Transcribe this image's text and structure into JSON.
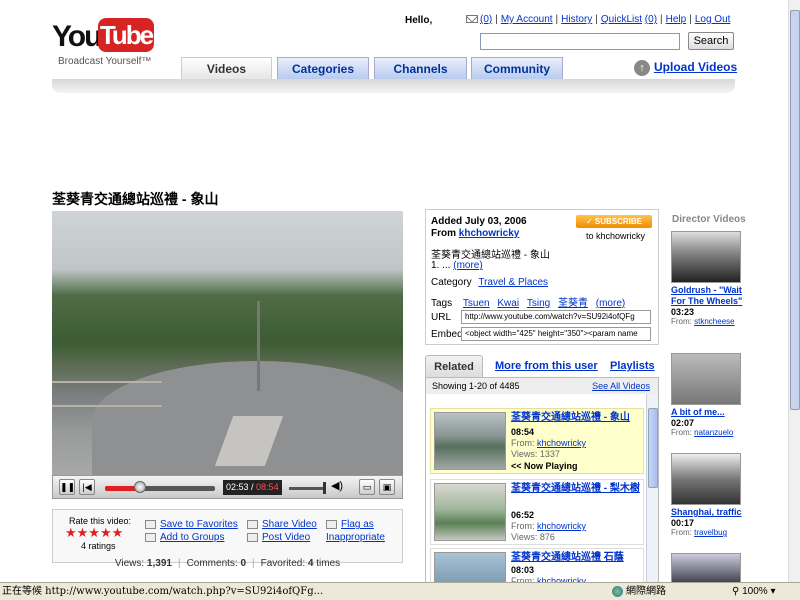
{
  "header": {
    "logo_you": "You",
    "logo_tube": "Tube",
    "tagline": "Broadcast Yourself™",
    "hello": "Hello,",
    "links": {
      "inbox_count": "(0)",
      "my_account": "My Account",
      "history": "History",
      "quicklist": "QuickList",
      "quicklist_count": "(0)",
      "help": "Help",
      "logout": "Log Out"
    },
    "search_label": "Search",
    "tabs": [
      "Videos",
      "Categories",
      "Channels",
      "Community"
    ],
    "upload": "Upload Videos"
  },
  "video": {
    "title": "荃葵青交通總站巡禮 - 象山",
    "time_current": "02:53",
    "time_total": "08:54",
    "progress_fraction": 0.32,
    "rate_label": "Rate this video:",
    "stars": "★★★★★",
    "ratings": "4 ratings",
    "actions": {
      "save_fav": "Save to Favorites",
      "add_groups": "Add to Groups",
      "share": "Share Video",
      "post": "Post Video",
      "flag1": "Flag as",
      "flag2": "Inappropriate"
    },
    "stats": {
      "views_label": "Views:",
      "views": "1,391",
      "comments_label": "Comments:",
      "comments": "0",
      "favorited_label": "Favorited:",
      "favorited": "4",
      "times": "times"
    }
  },
  "info": {
    "added_label": "Added",
    "added_date": "July 03, 2006",
    "from_label": "From",
    "from_user": "khchowricky",
    "subscribe": "✓ SUBSCRIBE",
    "to_user": "to khchowricky",
    "description": "荃葵青交通總站巡禮 - 象山",
    "desc_line2": "1. ...",
    "more": "(more)",
    "category_label": "Category",
    "category": "Travel & Places",
    "tags_label": "Tags",
    "tags": [
      "Tsuen",
      "Kwai",
      "Tsing",
      "荃葵青"
    ],
    "tags_more": "(more)",
    "url_label": "URL",
    "url_value": "http://www.youtube.com/watch?v=SU92i4ofQFg",
    "embed_label": "Embed",
    "embed_value": "<object width=\"425\" height=\"350\"><param name"
  },
  "related": {
    "tabs": [
      "Related",
      "More from this user",
      "Playlists"
    ],
    "showing": "Showing 1-20 of 4485",
    "see_all": "See All Videos",
    "from_label": "From:",
    "views_label": "Views:",
    "items": [
      {
        "title": "荃葵青交通總站巡禮 - 象山",
        "duration": "08:54",
        "from": "khchowricky",
        "views": "1337",
        "now_playing": "<< Now Playing"
      },
      {
        "title": "荃葵青交通總站巡禮 - 梨木樹",
        "duration": "06:52",
        "from": "khchowricky",
        "views": "876"
      },
      {
        "title": "荃葵青交通總站巡禮 石蔭",
        "duration": "08:03",
        "from": "khchowricky"
      }
    ]
  },
  "director": {
    "heading": "Director Videos",
    "from_label": "From:",
    "items": [
      {
        "title": "Goldrush - \"Wait For The Wheels\"",
        "duration": "03:23",
        "from": "stkncheese"
      },
      {
        "title": "A bit of me...",
        "duration": "02:07",
        "from": "natanzuelo"
      },
      {
        "title": "Shanghai, traffic",
        "duration": "00:17",
        "from": "travelbug"
      }
    ]
  },
  "statusbar": {
    "message": "正在等候 http://www.youtube.com/watch.php?v=SU92i4ofQFg...",
    "zone": "網際網路",
    "zoom": "100%"
  }
}
